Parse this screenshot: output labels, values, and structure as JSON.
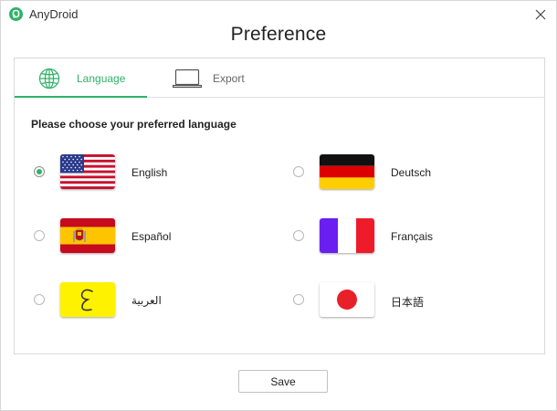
{
  "app": {
    "name": "AnyDroid",
    "logo_icon": "anydroid-logo-icon",
    "accent_color": "#2fb267"
  },
  "title": "Preference",
  "tabs": [
    {
      "label": "Language",
      "icon": "globe-icon",
      "active": true
    },
    {
      "label": "Export",
      "icon": "laptop-icon",
      "active": false
    }
  ],
  "prompt": "Please choose your preferred language",
  "languages": [
    {
      "label": "English",
      "flag": "us-flag-icon",
      "selected": true
    },
    {
      "label": "Deutsch",
      "flag": "germany-flag-icon",
      "selected": false
    },
    {
      "label": "Español",
      "flag": "spain-flag-icon",
      "selected": false
    },
    {
      "label": "Français",
      "flag": "france-flag-icon",
      "selected": false
    },
    {
      "label": "العربية",
      "flag": "arabic-flag-icon",
      "selected": false
    },
    {
      "label": "日本語",
      "flag": "japan-flag-icon",
      "selected": false
    }
  ],
  "save_label": "Save"
}
